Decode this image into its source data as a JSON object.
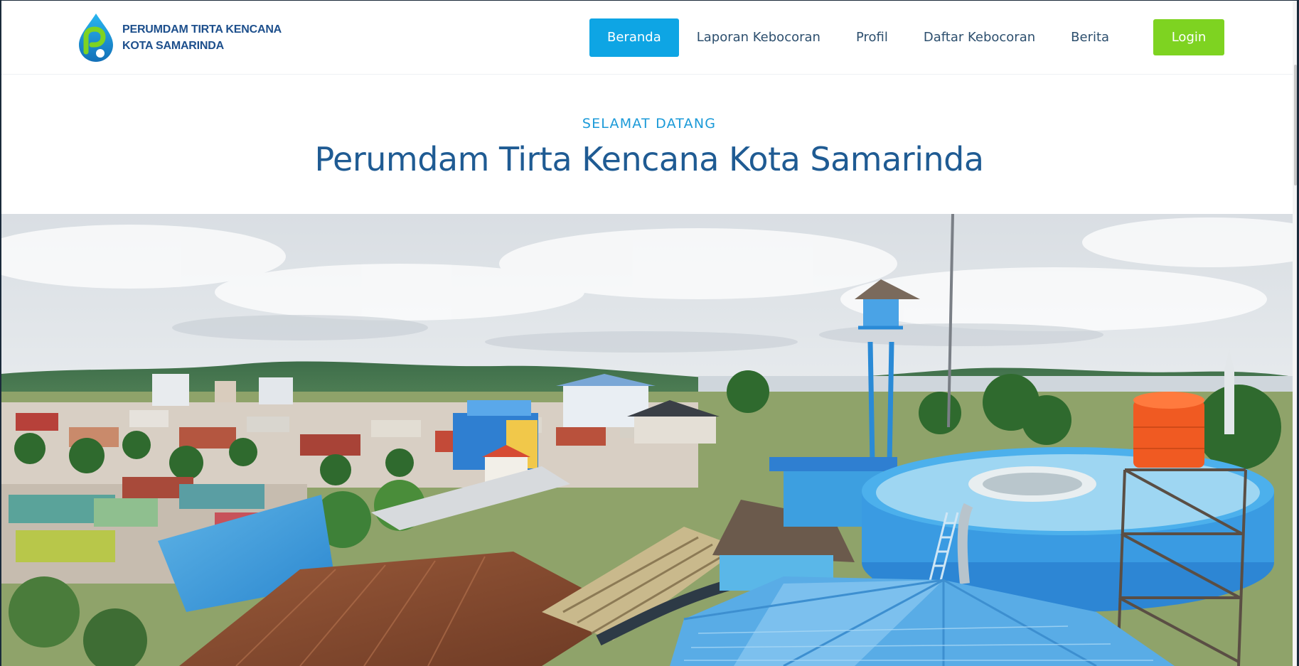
{
  "brand": {
    "line1": "PERUMDAM TIRTA KENCANA",
    "line2": "KOTA SAMARINDA",
    "icon": "water-drop-logo-icon"
  },
  "nav": {
    "items": [
      {
        "label": "Beranda",
        "active": true
      },
      {
        "label": "Laporan Kebocoran",
        "active": false
      },
      {
        "label": "Profil",
        "active": false
      },
      {
        "label": "Daftar Kebocoran",
        "active": false
      },
      {
        "label": "Berita",
        "active": false
      }
    ],
    "login_label": "Login"
  },
  "welcome": {
    "eyebrow": "SELAMAT DATANG",
    "title": "Perumdam Tirta Kencana Kota Samarinda"
  },
  "hero": {
    "image": "city-panorama-with-water-treatment-plant"
  },
  "colors": {
    "accent": "#0ea5e4",
    "login": "#7ed321",
    "title": "#1f5b93",
    "eyebrow": "#1b9ad8"
  }
}
